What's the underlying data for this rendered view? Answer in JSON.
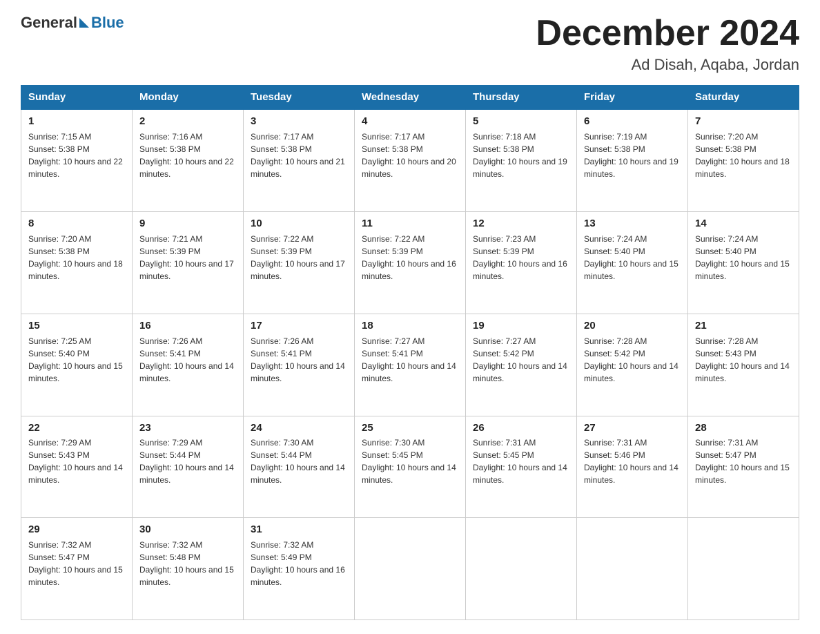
{
  "header": {
    "logo_general": "General",
    "logo_blue": "Blue",
    "main_title": "December 2024",
    "subtitle": "Ad Disah, Aqaba, Jordan"
  },
  "days_of_week": [
    "Sunday",
    "Monday",
    "Tuesday",
    "Wednesday",
    "Thursday",
    "Friday",
    "Saturday"
  ],
  "weeks": [
    [
      {
        "day": "1",
        "sunrise": "7:15 AM",
        "sunset": "5:38 PM",
        "daylight": "10 hours and 22 minutes."
      },
      {
        "day": "2",
        "sunrise": "7:16 AM",
        "sunset": "5:38 PM",
        "daylight": "10 hours and 22 minutes."
      },
      {
        "day": "3",
        "sunrise": "7:17 AM",
        "sunset": "5:38 PM",
        "daylight": "10 hours and 21 minutes."
      },
      {
        "day": "4",
        "sunrise": "7:17 AM",
        "sunset": "5:38 PM",
        "daylight": "10 hours and 20 minutes."
      },
      {
        "day": "5",
        "sunrise": "7:18 AM",
        "sunset": "5:38 PM",
        "daylight": "10 hours and 19 minutes."
      },
      {
        "day": "6",
        "sunrise": "7:19 AM",
        "sunset": "5:38 PM",
        "daylight": "10 hours and 19 minutes."
      },
      {
        "day": "7",
        "sunrise": "7:20 AM",
        "sunset": "5:38 PM",
        "daylight": "10 hours and 18 minutes."
      }
    ],
    [
      {
        "day": "8",
        "sunrise": "7:20 AM",
        "sunset": "5:38 PM",
        "daylight": "10 hours and 18 minutes."
      },
      {
        "day": "9",
        "sunrise": "7:21 AM",
        "sunset": "5:39 PM",
        "daylight": "10 hours and 17 minutes."
      },
      {
        "day": "10",
        "sunrise": "7:22 AM",
        "sunset": "5:39 PM",
        "daylight": "10 hours and 17 minutes."
      },
      {
        "day": "11",
        "sunrise": "7:22 AM",
        "sunset": "5:39 PM",
        "daylight": "10 hours and 16 minutes."
      },
      {
        "day": "12",
        "sunrise": "7:23 AM",
        "sunset": "5:39 PM",
        "daylight": "10 hours and 16 minutes."
      },
      {
        "day": "13",
        "sunrise": "7:24 AM",
        "sunset": "5:40 PM",
        "daylight": "10 hours and 15 minutes."
      },
      {
        "day": "14",
        "sunrise": "7:24 AM",
        "sunset": "5:40 PM",
        "daylight": "10 hours and 15 minutes."
      }
    ],
    [
      {
        "day": "15",
        "sunrise": "7:25 AM",
        "sunset": "5:40 PM",
        "daylight": "10 hours and 15 minutes."
      },
      {
        "day": "16",
        "sunrise": "7:26 AM",
        "sunset": "5:41 PM",
        "daylight": "10 hours and 14 minutes."
      },
      {
        "day": "17",
        "sunrise": "7:26 AM",
        "sunset": "5:41 PM",
        "daylight": "10 hours and 14 minutes."
      },
      {
        "day": "18",
        "sunrise": "7:27 AM",
        "sunset": "5:41 PM",
        "daylight": "10 hours and 14 minutes."
      },
      {
        "day": "19",
        "sunrise": "7:27 AM",
        "sunset": "5:42 PM",
        "daylight": "10 hours and 14 minutes."
      },
      {
        "day": "20",
        "sunrise": "7:28 AM",
        "sunset": "5:42 PM",
        "daylight": "10 hours and 14 minutes."
      },
      {
        "day": "21",
        "sunrise": "7:28 AM",
        "sunset": "5:43 PM",
        "daylight": "10 hours and 14 minutes."
      }
    ],
    [
      {
        "day": "22",
        "sunrise": "7:29 AM",
        "sunset": "5:43 PM",
        "daylight": "10 hours and 14 minutes."
      },
      {
        "day": "23",
        "sunrise": "7:29 AM",
        "sunset": "5:44 PM",
        "daylight": "10 hours and 14 minutes."
      },
      {
        "day": "24",
        "sunrise": "7:30 AM",
        "sunset": "5:44 PM",
        "daylight": "10 hours and 14 minutes."
      },
      {
        "day": "25",
        "sunrise": "7:30 AM",
        "sunset": "5:45 PM",
        "daylight": "10 hours and 14 minutes."
      },
      {
        "day": "26",
        "sunrise": "7:31 AM",
        "sunset": "5:45 PM",
        "daylight": "10 hours and 14 minutes."
      },
      {
        "day": "27",
        "sunrise": "7:31 AM",
        "sunset": "5:46 PM",
        "daylight": "10 hours and 14 minutes."
      },
      {
        "day": "28",
        "sunrise": "7:31 AM",
        "sunset": "5:47 PM",
        "daylight": "10 hours and 15 minutes."
      }
    ],
    [
      {
        "day": "29",
        "sunrise": "7:32 AM",
        "sunset": "5:47 PM",
        "daylight": "10 hours and 15 minutes."
      },
      {
        "day": "30",
        "sunrise": "7:32 AM",
        "sunset": "5:48 PM",
        "daylight": "10 hours and 15 minutes."
      },
      {
        "day": "31",
        "sunrise": "7:32 AM",
        "sunset": "5:49 PM",
        "daylight": "10 hours and 16 minutes."
      },
      null,
      null,
      null,
      null
    ]
  ]
}
